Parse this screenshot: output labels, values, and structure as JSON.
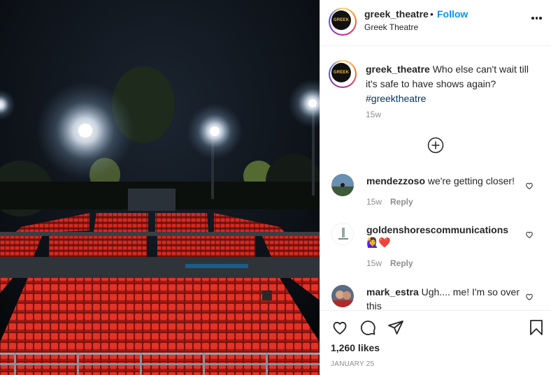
{
  "post": {
    "username": "greek_theatre",
    "dot": "•",
    "follow_label": "Follow",
    "location": "Greek Theatre",
    "avatar_logo_text": "GREEK",
    "caption_text": "Who else can't wait till it's safe to have shows again?",
    "hashtag": "#greektheatre",
    "caption_time": "15w"
  },
  "comments": [
    {
      "username": "mendezzoso",
      "text": "we're getting closer!",
      "emoji": "",
      "time": "15w",
      "reply_label": "Reply"
    },
    {
      "username": "goldenshorescommunications",
      "text": "",
      "emoji": "🙋‍♀️❤️",
      "time": "15w",
      "reply_label": "Reply"
    },
    {
      "username": "mark_estra",
      "text": "Ugh.... me! I'm so over this",
      "emoji": "",
      "time": "",
      "reply_label": ""
    }
  ],
  "footer": {
    "likes": "1,260 likes",
    "date": "January 25"
  },
  "icons": {
    "more": "more-options-icon",
    "load_more": "plus-circle-icon",
    "like": "heart-icon",
    "comment": "comment-icon",
    "share": "share-icon",
    "save": "bookmark-icon"
  },
  "colors": {
    "follow": "#0095f6",
    "hashtag": "#00376b",
    "muted": "#8e8e8e",
    "seats": "#d8281f"
  }
}
